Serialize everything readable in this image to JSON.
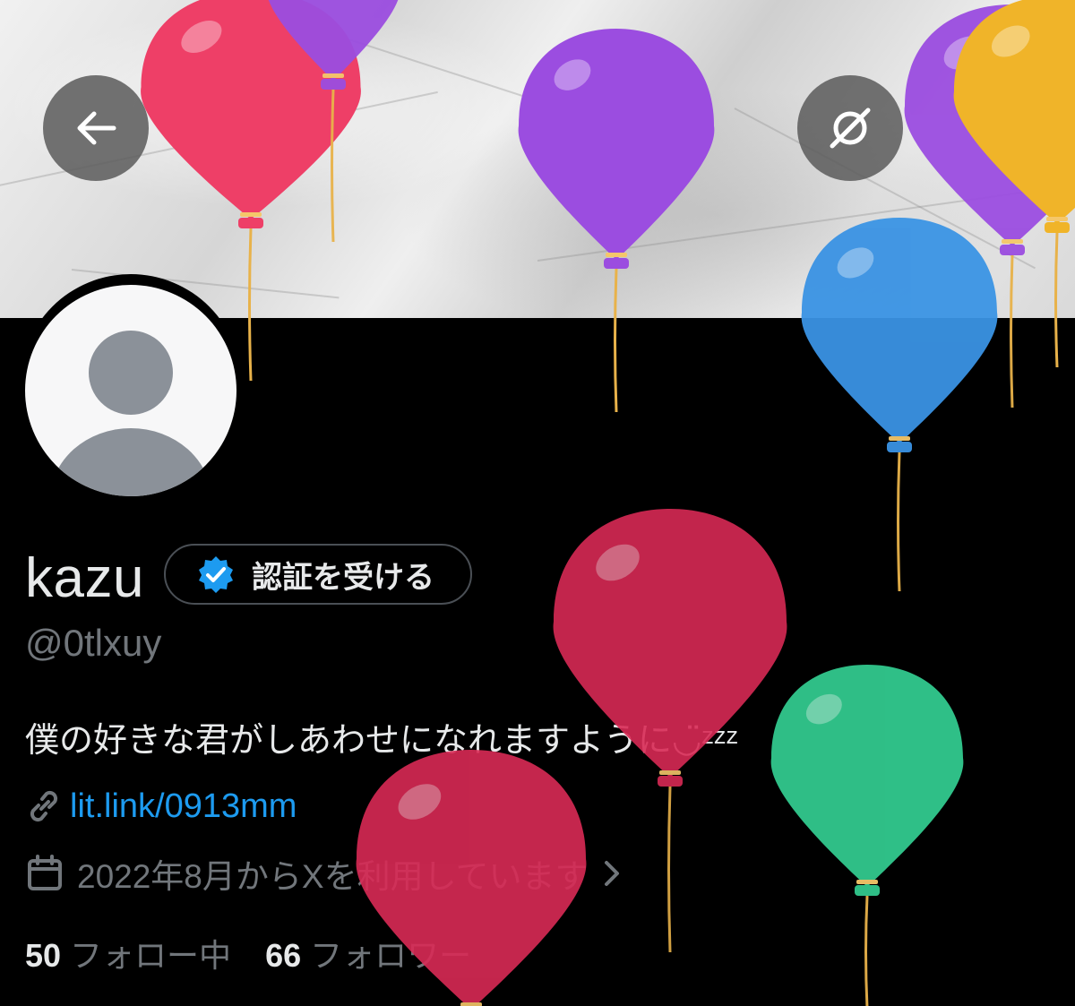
{
  "header": {
    "back_icon": "arrow-left-icon",
    "hide_icon": "eye-slash-icon"
  },
  "profile": {
    "display_name": "kazu",
    "verify_button_label": "認証を受ける",
    "verify_icon": "verified-badge-icon",
    "handle": "@0tlxuy",
    "bio": "僕の好きな君がしあわせになれますように◡̈ᶻᶻᶻ",
    "link_icon": "link-icon",
    "link_text": "lit.link/0913mm",
    "joined_icon": "calendar-icon",
    "joined_text": "2022年8月からXを利用しています",
    "joined_chevron_icon": "chevron-right-icon",
    "following_count": "50",
    "following_label": "フォロー中",
    "followers_count": "66",
    "followers_label": "フォロワー"
  },
  "colors": {
    "accent": "#1d9bf0",
    "primary_text": "#e7e9ea",
    "secondary_text": "#71767b",
    "background": "#000000"
  },
  "birthday_balloons": {
    "colors": [
      "#ee3f67",
      "#9b4de0",
      "#9b4de0",
      "#9b4de0",
      "#f0b429",
      "#3a93e4",
      "#d92a55",
      "#32c98e",
      "#d92a55"
    ]
  }
}
